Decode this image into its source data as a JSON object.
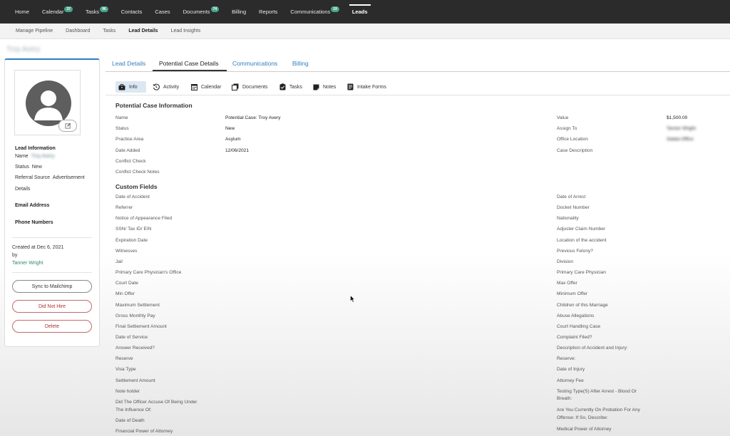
{
  "top_nav": [
    {
      "label": "Home"
    },
    {
      "label": "Calendar",
      "badge": "37"
    },
    {
      "label": "Tasks",
      "badge": "96"
    },
    {
      "label": "Contacts"
    },
    {
      "label": "Cases"
    },
    {
      "label": "Documents",
      "badge": "74"
    },
    {
      "label": "Billing"
    },
    {
      "label": "Reports"
    },
    {
      "label": "Communications",
      "badge": "19"
    },
    {
      "label": "Leads",
      "active": true
    }
  ],
  "sub_nav": [
    "Manage Pipeline",
    "Dashboard",
    "Tasks",
    "Lead Details",
    "Lead Insights"
  ],
  "sub_nav_active": "Lead Details",
  "page_title": "Troy Avery",
  "lead_card": {
    "lead_information_heading": "Lead Information",
    "name_label": "Name",
    "name_value": "Troy Avery",
    "status_label": "Status",
    "status_value": "New",
    "referral_label": "Referral Source",
    "referral_value": "Advertisement",
    "details_label": "Details",
    "email_heading": "Email Address",
    "phone_heading": "Phone Numbers",
    "created_at": "Created at Dec 6, 2021",
    "created_by_label": "by",
    "created_by": "Tanner Wright",
    "sync_button": "Sync to Mailchimp",
    "did_not_hire_button": "Did Not Hire",
    "delete_button": "Delete"
  },
  "main_tabs": [
    "Lead Details",
    "Potential Case Details",
    "Communications",
    "Billing"
  ],
  "main_tab_active": "Potential Case Details",
  "sub_tabs": [
    {
      "label": "Info",
      "icon": "briefcase-icon"
    },
    {
      "label": "Activity",
      "icon": "history-icon"
    },
    {
      "label": "Calendar",
      "icon": "calendar-icon"
    },
    {
      "label": "Documents",
      "icon": "documents-icon"
    },
    {
      "label": "Tasks",
      "icon": "tasks-icon"
    },
    {
      "label": "Notes",
      "icon": "notes-icon"
    },
    {
      "label": "Intake Forms",
      "icon": "intake-forms-icon"
    }
  ],
  "potential_case": {
    "heading": "Potential Case Information",
    "left": [
      {
        "label": "Name",
        "value": "Potential Case: Troy Avery"
      },
      {
        "label": "Status",
        "value": "New"
      },
      {
        "label": "Practice Area",
        "value": "Asylum"
      },
      {
        "label": "Date Added",
        "value": "12/06/2021"
      },
      {
        "label": "Conflict Check",
        "value": ""
      },
      {
        "label": "Conflict Check Notes",
        "value": ""
      }
    ],
    "right": [
      {
        "label": "Value",
        "value": "$1,500.00"
      },
      {
        "label": "Assign To",
        "value": "Tanner Wright"
      },
      {
        "label": "Office Location",
        "value": "Salata Office"
      },
      {
        "label": "Case Description",
        "value": ""
      }
    ]
  },
  "custom_fields": {
    "heading": "Custom Fields",
    "left": [
      "Date of Accident",
      "Referrer",
      "Notice of Appearance Filed",
      "SSN/ Tax ID/ EIN",
      "Expiration Date",
      "Witnesses",
      "Jail",
      "Primary Care Physician's Office",
      "Court Date",
      "Min Offer",
      "Maximum Settlement",
      "Gross Monthly Pay",
      "Final Settlement Amount",
      "Date of Service",
      "Answer Received?",
      "Reserve",
      "Visa Type",
      "Settlement Amount",
      "Note holder",
      "Did The Officer Accuse Of Being Under",
      "The Influence Of:",
      "Date of Death",
      "Financial Power of Attorney"
    ],
    "right": [
      "Date of Arrest",
      "Docket Number",
      "Nationality",
      "Adjuster Claim Number",
      "Location of the accident",
      "Previous Felony?",
      "Division",
      "Primary Care Physician",
      "Max Offer",
      "Minimum Offer",
      "Children of this Marriage",
      "Abuse Allegations",
      "Court Handling Case",
      "Complaint Filed?",
      "Description of Accident and Injury:",
      "Reserve:",
      "Date of Injury",
      "Attorney Fee",
      "Testing Type(S) After Arrest - Blood Or",
      "Breath:",
      "Are You Currently On Probation For Any",
      "Offense: If So, Describe:",
      "Medical Power of Attorney"
    ]
  }
}
